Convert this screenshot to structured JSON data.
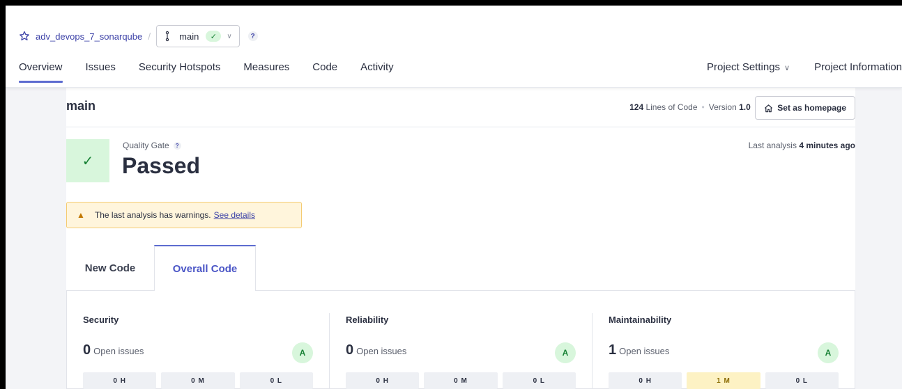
{
  "header": {
    "project_name": "adv_devops_7_sonarqube",
    "separator": "/",
    "branch": "main",
    "branch_status_mark": "✓",
    "help_mark": "?"
  },
  "nav": {
    "tabs": [
      "Overview",
      "Issues",
      "Security Hotspots",
      "Measures",
      "Code",
      "Activity"
    ],
    "active": "Overview",
    "project_settings": "Project Settings",
    "project_information": "Project Information"
  },
  "summary": {
    "branch_title": "main",
    "loc_value": "124",
    "loc_label": "Lines of Code",
    "version_label": "Version",
    "version_value": "1.0",
    "set_homepage": "Set as homepage"
  },
  "quality_gate": {
    "label": "Quality Gate",
    "status": "Passed",
    "check_mark": "✓",
    "last_analysis_prefix": "Last analysis",
    "last_analysis_value": "4 minutes ago"
  },
  "warning": {
    "text": "The last analysis has warnings.",
    "link": "See details"
  },
  "code_tabs": {
    "new": "New Code",
    "overall": "Overall Code",
    "active": "overall"
  },
  "metrics": [
    {
      "title": "Security",
      "count": "0",
      "count_label": "Open issues",
      "grade": "A",
      "h": "0 H",
      "m": "0 M",
      "l": "0 L"
    },
    {
      "title": "Reliability",
      "count": "0",
      "count_label": "Open issues",
      "grade": "A",
      "h": "0 H",
      "m": "0 M",
      "l": "0 L"
    },
    {
      "title": "Maintainability",
      "count": "1",
      "count_label": "Open issues",
      "grade": "A",
      "h": "0 H",
      "m": "1 M",
      "l": "0 L"
    }
  ],
  "colors": {
    "accent": "#5d6cd0",
    "link": "#3e43a8",
    "passed_bg": "#d8f6dc",
    "passed_fg": "#198236",
    "warning_bg": "#fff5dc",
    "warning_border": "#f4cb71",
    "medium_bg": "#fdf2c4"
  }
}
